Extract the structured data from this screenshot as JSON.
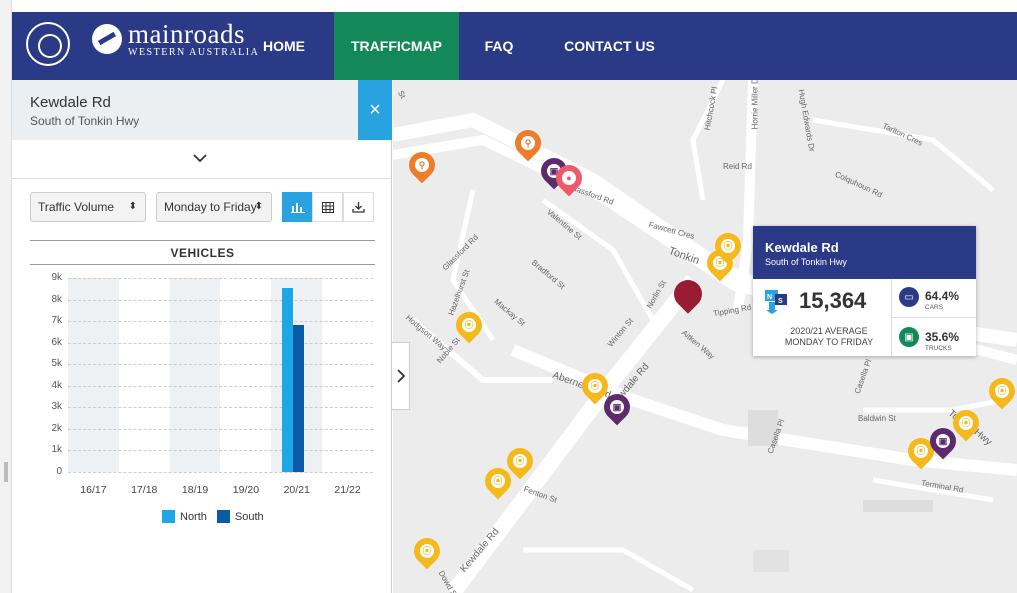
{
  "header": {
    "brand_name": "mainroads",
    "brand_sub": "WESTERN AUSTRALIA",
    "nav": [
      "HOME",
      "TRAFFICMAP",
      "FAQ",
      "CONTACT US"
    ],
    "active_nav": "TRAFFICMAP",
    "colors": {
      "bar": "#2a3a86",
      "active": "#13895a"
    }
  },
  "panel": {
    "location_name": "Kewdale Rd",
    "location_sub": "South of Tonkin Hwy",
    "close_glyph": "×",
    "metric_select": "Traffic Volume",
    "day_select": "Monday to Friday",
    "view_buttons": [
      "bar-chart-icon",
      "table-icon",
      "download-icon"
    ],
    "chart_title": "VEHICLES"
  },
  "chart_data": {
    "type": "bar",
    "title": "VEHICLES",
    "categories": [
      "16/17",
      "17/18",
      "18/19",
      "19/20",
      "20/21",
      "21/22"
    ],
    "yticks": [
      "9k",
      "8k",
      "7k",
      "6k",
      "5k",
      "4k",
      "3k",
      "2k",
      "1k",
      "0"
    ],
    "ylim": [
      0,
      9000
    ],
    "series": [
      {
        "name": "North",
        "color": "#1da7e6",
        "values": [
          null,
          null,
          null,
          null,
          8550,
          null
        ]
      },
      {
        "name": "South",
        "color": "#0b5aa8",
        "values": [
          null,
          null,
          null,
          null,
          6800,
          null
        ]
      }
    ],
    "legend": [
      "North",
      "South"
    ],
    "legend_position": "bottom"
  },
  "popup": {
    "name": "Kewdale Rd",
    "sub": "South of Tonkin Hwy",
    "ns_label": "N S",
    "count": "15,364",
    "avg_line1": "2020/21 AVERAGE",
    "avg_line2": "MONDAY TO FRIDAY",
    "cars_pct": "64.4%",
    "cars_label": "CARS",
    "trucks_pct": "35.6%",
    "trucks_label": "TRUCKS"
  },
  "map": {
    "streets": [
      "Tarlton Cres",
      "Hitchcock Pl",
      "Hugh Edwards Dr",
      "Reid Rd",
      "Horrie Miller Dr",
      "Colquhoun Rd",
      "Fawcett Cres",
      "Glassford Rd",
      "Valentine St",
      "Tonkin",
      "Bradford St",
      "Norlin St",
      "Tipping Rd",
      "Hazelhurst St",
      "Mackay St",
      "Winton St",
      "Aitken Way",
      "Noble St",
      "Hodgson Way",
      "Abernethy Rd",
      "Kewdale Rd",
      "Baldwin St",
      "Terminal Rd",
      "Casella Pl",
      "Fenton St",
      "Dowd St"
    ],
    "pin_glyphs": {
      "signal": "⦿",
      "bike": "⚲",
      "truck": "▣",
      "person": "●"
    }
  }
}
